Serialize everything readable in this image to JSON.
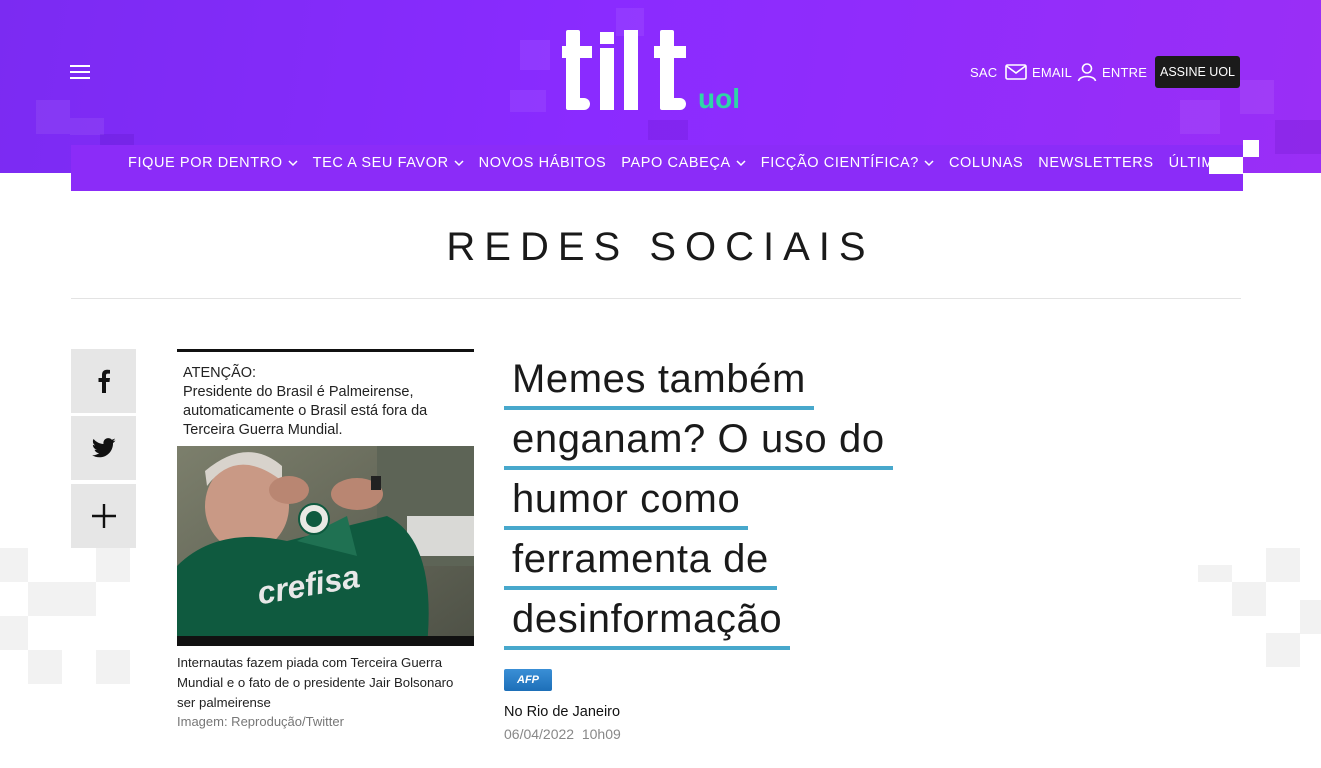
{
  "header": {
    "brand": "tilt",
    "sub_brand": "uol",
    "utility": {
      "sac": "SAC",
      "email": "EMAIL",
      "entre": "ENTRE",
      "assine": "ASSINE UOL"
    },
    "colors": {
      "header_bg": "#8a2bff",
      "accent": "#48a8cc",
      "uol_green": "#2fd5a6"
    }
  },
  "nav": {
    "items": [
      {
        "label": "FIQUE POR DENTRO",
        "has_dropdown": true
      },
      {
        "label": "TEC A SEU FAVOR",
        "has_dropdown": true
      },
      {
        "label": "NOVOS HÁBITOS",
        "has_dropdown": false
      },
      {
        "label": "PAPO CABEÇA",
        "has_dropdown": true
      },
      {
        "label": "FICÇÃO CIENTÍFICA?",
        "has_dropdown": true
      },
      {
        "label": "COLUNAS",
        "has_dropdown": false
      },
      {
        "label": "NEWSLETTERS",
        "has_dropdown": false
      },
      {
        "label": "ÚLTIMAS",
        "has_dropdown": false
      }
    ]
  },
  "section": {
    "title": "REDES SOCIAIS"
  },
  "share": {
    "icons": [
      "facebook-icon",
      "twitter-icon",
      "plus-icon"
    ]
  },
  "figure": {
    "meme_heading": "ATENÇÃO:",
    "meme_text": "Presidente do Brasil é Palmeirense, automaticamente o Brasil está fora da Terceira Guerra Mundial.",
    "jersey_text": "crefisa",
    "caption": "Internautas fazem piada com Terceira Guerra Mundial e o fato de o presidente Jair Bolsonaro ser palmeirense",
    "credit": "Imagem: Reprodução/Twitter"
  },
  "article": {
    "headline_lines": [
      "Memes também",
      "enganam? O uso do",
      "humor como",
      "ferramenta de",
      "desinformação"
    ],
    "agency": "AFP",
    "location": "No Rio de Janeiro",
    "date": "06/04/2022",
    "time": "10h09"
  }
}
